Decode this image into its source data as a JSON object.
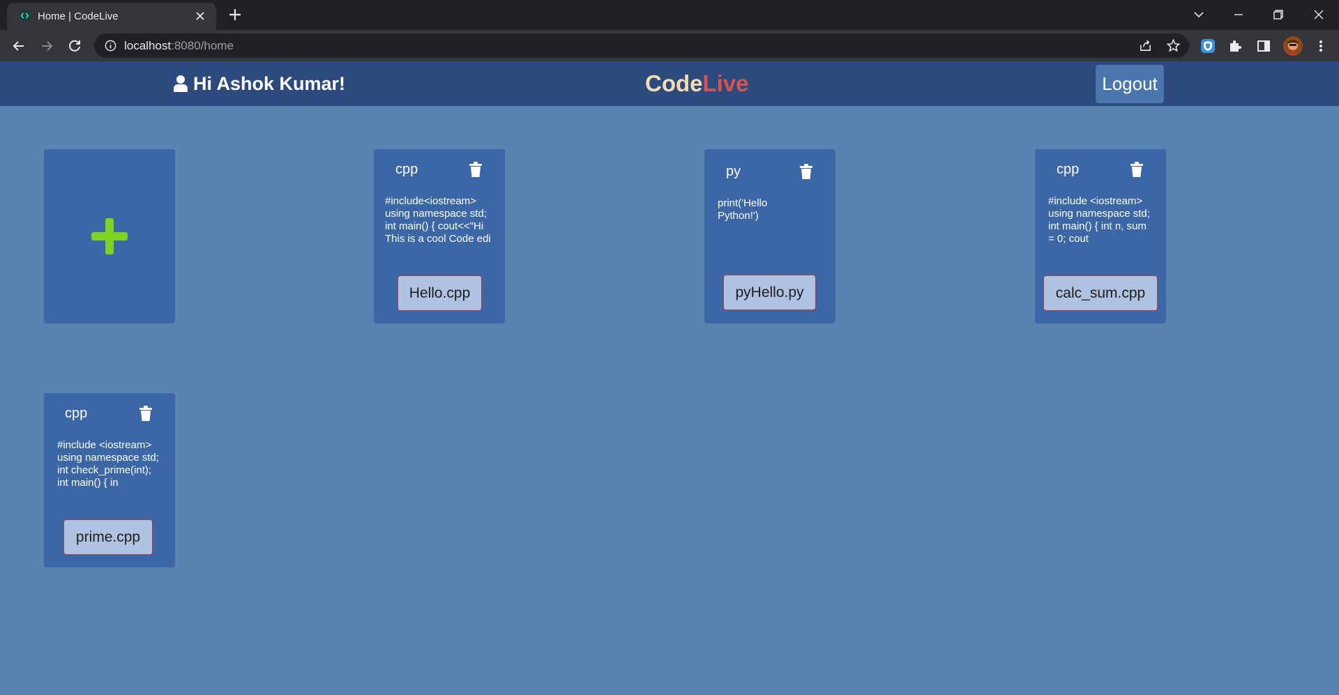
{
  "browser": {
    "tab_title": "Home | CodeLive",
    "url_host": "localhost",
    "url_path": ":8080/home"
  },
  "header": {
    "greeting": "Hi Ashok Kumar!",
    "brand_code": "Code",
    "brand_live": "Live",
    "logout_label": "Logout"
  },
  "files": [
    {
      "lang": "cpp",
      "snippet": "#include<iostream> using namespace std; int main() { cout<<\"Hi This is a cool Code edi",
      "filename": "Hello.cpp"
    },
    {
      "lang": "py",
      "snippet": "print('Hello Python!')",
      "filename": "pyHello.py"
    },
    {
      "lang": "cpp",
      "snippet": "#include <iostream> using namespace std; int main() { int n, sum = 0; cout",
      "filename": "calc_sum.cpp"
    },
    {
      "lang": "cpp",
      "snippet": "#include <iostream> using namespace std; int check_prime(int); int main() { in",
      "filename": "prime.cpp"
    }
  ],
  "colors": {
    "page_bg": "#5884b1",
    "header_bg": "#2c4a7e",
    "card_bg": "#3c67a6",
    "plus": "#7ed321",
    "brand_code": "#f5dbb0",
    "brand_live": "#d9534f"
  }
}
